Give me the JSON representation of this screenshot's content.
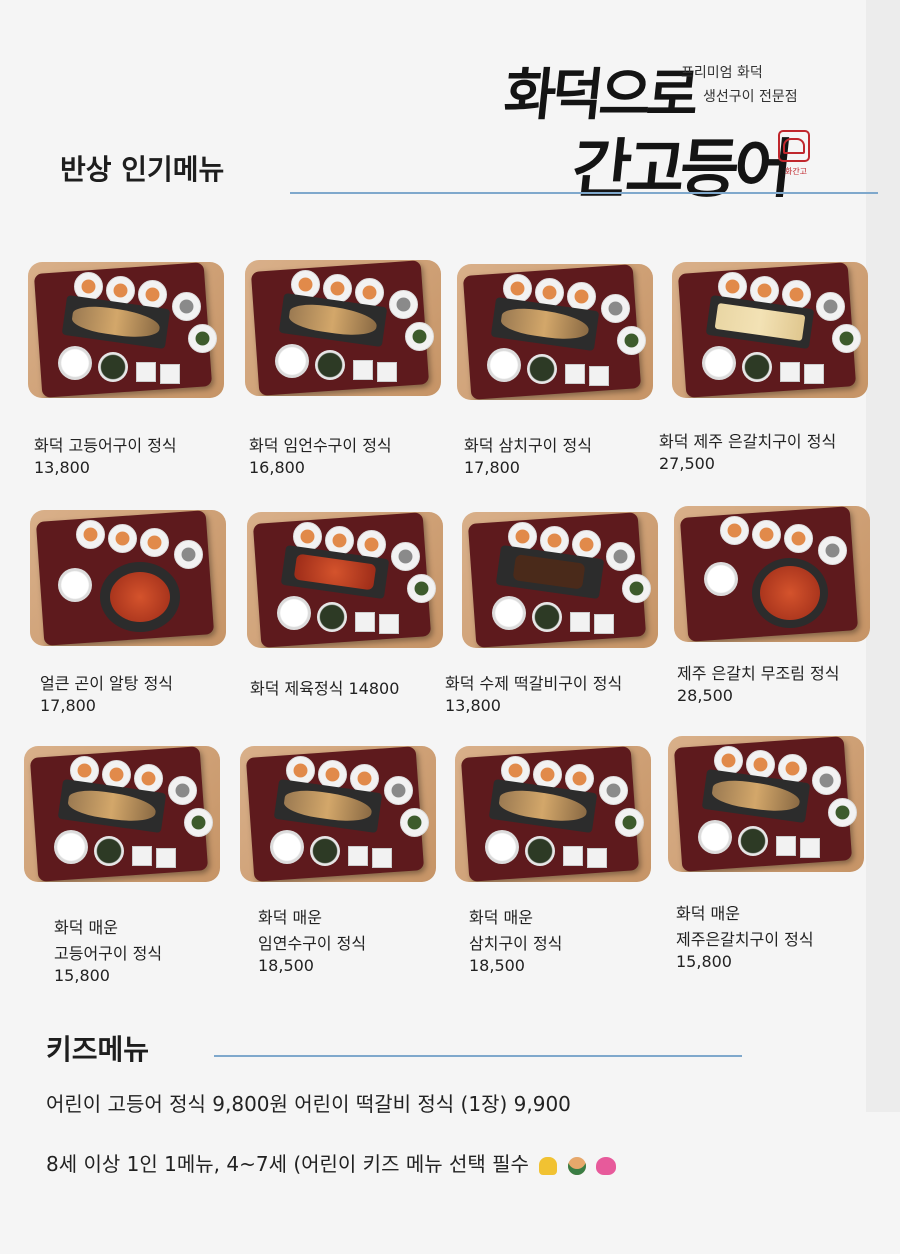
{
  "brand": {
    "logo_line1": "화덕으로",
    "logo_line2": "간고등어",
    "tagline1": "프리미엄 화덕",
    "tagline2": "생선구이 전문점",
    "seal_text": "화간고"
  },
  "sections": {
    "popular_title": "반상 인기메뉴",
    "kids_title": "키즈메뉴"
  },
  "menu": [
    {
      "name": "화덕 고등어구이 정식",
      "price": "13,800"
    },
    {
      "name": "화덕 임언수구이 정식",
      "price": "16,800"
    },
    {
      "name": "화덕 삼치구이 정식",
      "price": "17,800"
    },
    {
      "name": "화덕 제주 은갈치구이 정식",
      "price": "27,500"
    },
    {
      "name": "얼큰 곤이 알탕 정식",
      "price": "17,800"
    },
    {
      "name": "화덕 제육정식 14800",
      "price": ""
    },
    {
      "name": "화덕 수제 떡갈비구이 정식",
      "price": "13,800"
    },
    {
      "name": "제주 은갈치 무조림 정식",
      "price": "28,500"
    },
    {
      "name_line1": "화덕 매운",
      "name_line2": "고등어구이 정식",
      "price": "15,800"
    },
    {
      "name_line1": "화덕 매운",
      "name_line2": "임연수구이 정식",
      "price": "18,500"
    },
    {
      "name_line1": "화덕 매운",
      "name_line2": "삼치구이 정식",
      "price": "18,500"
    },
    {
      "name_line1": "화덕  매운",
      "name_line2": "제주은갈치구이 정식",
      "price": "15,800"
    }
  ],
  "kids": {
    "line1": "어린이 고등어 정식 9,800원  어린이 떡갈비 정식 (1장) 9,900",
    "line2": "8세 이상 1인 1메뉴, 4~7세 (어린이 키즈 메뉴 선택 필수"
  },
  "icons": [
    "folded-hands-icon",
    "person-icon",
    "hearts-icon"
  ]
}
